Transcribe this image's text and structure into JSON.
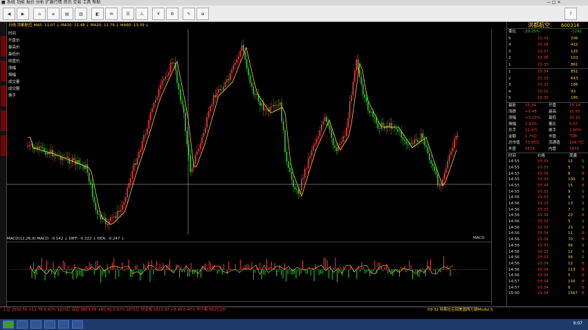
{
  "colors": {
    "up": "#ff3b3b",
    "down": "#2bd12b",
    "ma": "#ffd23f",
    "bg": "#000000",
    "crosshair": "#cccccc"
  },
  "window": {
    "app_icon": "app-logo-icon"
  },
  "stock": {
    "name": "洪都航空",
    "code": "600316"
  },
  "chart_info": "日线 洪都航空 MA5: 11.07 ↓ MA10: 11.48 ↓ MA20: 11.79 ↓ MA60: 13.39 ↓",
  "macd_info": "MACD(12,26,9) MACD: -0.142 ↓ DIFF: -0.322 ↓ DEA: -0.247 ↓",
  "macd_label": "MACD",
  "left_panel": [
    "时间",
    "开盘价",
    "最高价",
    "最低价",
    "收盘价",
    "涨幅",
    "振幅",
    "成交量",
    "成交额",
    "换手"
  ],
  "order_book": {
    "weibi_label": "委比",
    "weibi_value": "-29.25%",
    "weicha_value": "-1242",
    "asks": [
      {
        "level": "5",
        "price": "15.39",
        "vol": "206"
      },
      {
        "level": "4",
        "price": "15.38",
        "vol": "412"
      },
      {
        "level": "3",
        "price": "15.37",
        "vol": "125"
      },
      {
        "level": "2",
        "price": "15.36",
        "vol": "103"
      },
      {
        "level": "1",
        "price": "15.35",
        "vol": "861"
      }
    ],
    "bids": [
      {
        "level": "1",
        "price": "15.34",
        "vol": "851"
      },
      {
        "level": "2",
        "price": "15.33",
        "vol": "643"
      },
      {
        "level": "3",
        "price": "15.32",
        "vol": "186"
      },
      {
        "level": "4",
        "price": "15.31",
        "vol": "93"
      },
      {
        "level": "5",
        "price": "15.30",
        "vol": "185"
      }
    ]
  },
  "stats": [
    {
      "l1": "最新",
      "v1": "15.34",
      "l2": "开盘",
      "v2": "15.14"
    },
    {
      "l1": "涨跌",
      "v1": "+0.48",
      "l2": "最高",
      "v2": "15.55"
    },
    {
      "l1": "涨幅",
      "v1": "+3.23%",
      "l2": "最低",
      "v2": "15.12"
    },
    {
      "l1": "振幅",
      "v1": "2.93%",
      "l2": "量比",
      "v2": "0.67"
    },
    {
      "l1": "总手",
      "v1": "11.4万",
      "l2": "换手",
      "v2": "1.60%"
    },
    {
      "l1": "金额",
      "v1": "1.75亿",
      "l2": "市盈",
      "v2": "亏损"
    },
    {
      "l1": "总市值",
      "v1": "73.95亿",
      "l2": "流通值",
      "v2": "109.7亿"
    },
    {
      "l1": "外盘",
      "v1": "5574",
      "l2": "内盘",
      "v2": "5876"
    }
  ],
  "ticks_header": {
    "time": "时间",
    "price": "价格",
    "vol": "现量"
  },
  "ticks": [
    {
      "t": "14:55",
      "p": "15.33",
      "v": "12",
      "d": "S"
    },
    {
      "t": "14:55",
      "p": "15.33",
      "v": "5",
      "d": "S"
    },
    {
      "t": "14:55",
      "p": "15.34",
      "v": "8",
      "d": "B"
    },
    {
      "t": "14:55",
      "p": "15.33",
      "v": "100",
      "d": "S"
    },
    {
      "t": "14:55",
      "p": "15.34",
      "v": "15",
      "d": "B"
    },
    {
      "t": "14:55",
      "p": "15.33",
      "v": "9",
      "d": "S"
    },
    {
      "t": "14:56",
      "p": "15.33",
      "v": "9",
      "d": "S"
    },
    {
      "t": "14:56",
      "p": "15.33",
      "v": "13",
      "d": "S"
    },
    {
      "t": "14:56",
      "p": "15.33",
      "v": "7",
      "d": "S"
    },
    {
      "t": "14:56",
      "p": "15.34",
      "v": "20",
      "d": "B"
    },
    {
      "t": "14:56",
      "p": "15.33",
      "v": "5",
      "d": "S"
    },
    {
      "t": "14:56",
      "p": "15.33",
      "v": "23",
      "d": "S"
    },
    {
      "t": "14:56",
      "p": "15.34",
      "v": "11",
      "d": "B"
    },
    {
      "t": "14:56",
      "p": "15.34",
      "v": "70",
      "d": "B"
    },
    {
      "t": "14:56",
      "p": "15.33",
      "v": "96",
      "d": "S"
    },
    {
      "t": "14:56",
      "p": "15.33",
      "v": "12",
      "d": "S"
    },
    {
      "t": "14:56",
      "p": "15.33",
      "v": "56",
      "d": "S"
    },
    {
      "t": "14:56",
      "p": "15.34",
      "v": "12",
      "d": "B"
    },
    {
      "t": "14:56",
      "p": "15.34",
      "v": "113",
      "d": "B"
    },
    {
      "t": "14:56",
      "p": "15.34",
      "v": "5",
      "d": "B"
    },
    {
      "t": "14:57",
      "p": "15.34",
      "v": "116",
      "d": "B"
    },
    {
      "t": "14:57",
      "p": "15.34",
      "v": "8",
      "d": "B"
    },
    {
      "t": "15:00",
      "p": "15.34",
      "v": "1567",
      "d": "B"
    }
  ],
  "statusbar": "上证 2930.55 +11.78 0.40% 1429亿  深证 9813.38 +60.41 0.62% 1871亿  创业板 1810.97 +8.46 0.47%  中小板 5625.29",
  "statusbar_right": "09:32 特斯拉召回美国两万辆Model S",
  "clock": "9:07"
}
